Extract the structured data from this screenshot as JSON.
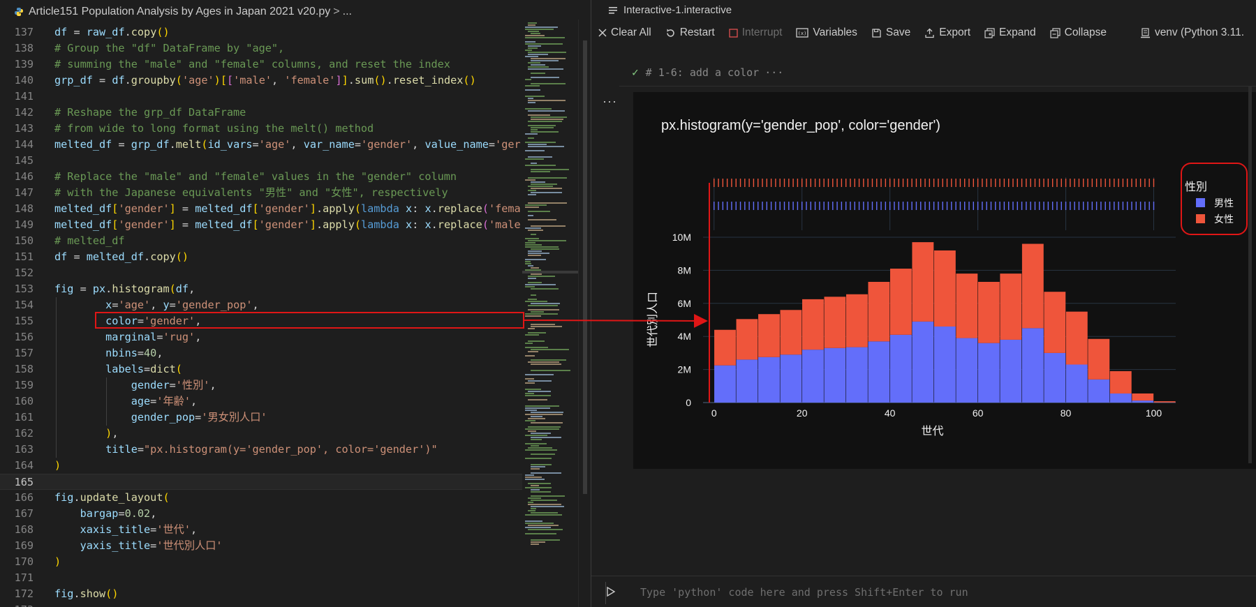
{
  "editor": {
    "breadcrumb": {
      "file": "Article151 Population Analysis by Ages in Japan 2021 v20.py",
      "sep": ">",
      "rest": "..."
    },
    "lines": [
      {
        "n": "137",
        "t": "df = raw_df.copy()"
      },
      {
        "n": "138",
        "t": "# Group the \"df\" DataFrame by \"age\","
      },
      {
        "n": "139",
        "t": "# summing the \"male\" and \"female\" columns, and reset the index"
      },
      {
        "n": "140",
        "t": "grp_df = df.groupby('age')[['male', 'female']].sum().reset_index()"
      },
      {
        "n": "141",
        "t": ""
      },
      {
        "n": "142",
        "t": "# Reshape the grp_df DataFrame"
      },
      {
        "n": "143",
        "t": "# from wide to long format using the melt() method"
      },
      {
        "n": "144",
        "t": "melted_df = grp_df.melt(id_vars='age', var_name='gender', value_name='ger"
      },
      {
        "n": "145",
        "t": ""
      },
      {
        "n": "146",
        "t": "# Replace the \"male\" and \"female\" values in the \"gender\" column"
      },
      {
        "n": "147",
        "t": "# with the Japanese equivalents \"男性\" and \"女性\", respectively"
      },
      {
        "n": "148",
        "t": "melted_df['gender'] = melted_df['gender'].apply(lambda x: x.replace('fema"
      },
      {
        "n": "149",
        "t": "melted_df['gender'] = melted_df['gender'].apply(lambda x: x.replace('male"
      },
      {
        "n": "150",
        "t": "# melted_df"
      },
      {
        "n": "151",
        "t": "df = melted_df.copy()"
      },
      {
        "n": "152",
        "t": ""
      },
      {
        "n": "153",
        "t": "fig = px.histogram(df,"
      },
      {
        "n": "154",
        "t": "        x='age', y='gender_pop',"
      },
      {
        "n": "155",
        "t": "        color='gender',"
      },
      {
        "n": "156",
        "t": "        marginal='rug',"
      },
      {
        "n": "157",
        "t": "        nbins=40,"
      },
      {
        "n": "158",
        "t": "        labels=dict("
      },
      {
        "n": "159",
        "t": "            gender='性別',"
      },
      {
        "n": "160",
        "t": "            age='年齢',"
      },
      {
        "n": "161",
        "t": "            gender_pop='男女別人口'"
      },
      {
        "n": "162",
        "t": "        ),"
      },
      {
        "n": "163",
        "t": "        title=\"px.histogram(y='gender_pop', color='gender')\""
      },
      {
        "n": "164",
        "t": ")"
      },
      {
        "n": "165",
        "t": ""
      },
      {
        "n": "166",
        "t": "fig.update_layout("
      },
      {
        "n": "167",
        "t": "    bargap=0.02,"
      },
      {
        "n": "168",
        "t": "    xaxis_title='世代',"
      },
      {
        "n": "169",
        "t": "    yaxis_title='世代別人口'"
      },
      {
        "n": "170",
        "t": ")"
      },
      {
        "n": "171",
        "t": ""
      },
      {
        "n": "172",
        "t": "fig.show()"
      },
      {
        "n": "173",
        "t": ""
      }
    ]
  },
  "interactive": {
    "tab_title": "Interactive-1.interactive",
    "toolbar": {
      "clear_all": "Clear All",
      "restart": "Restart",
      "interrupt": "Interrupt",
      "variables": "Variables",
      "save": "Save",
      "export": "Export",
      "expand": "Expand",
      "collapse": "Collapse",
      "kernel": "venv (Python 3.11."
    },
    "cell_header": "# 1-6: add a color",
    "cell_header_more": "···",
    "more_actions": "···",
    "input_placeholder": "Type 'python' code here and press Shift+Enter to run"
  },
  "colors": {
    "male": "#636efa",
    "female": "#ef553b",
    "annotation": "#e01616",
    "plot_bg": "#111111"
  },
  "chart_data": {
    "type": "bar",
    "title": "px.histogram(y='gender_pop', color='gender')",
    "xlabel": "世代",
    "ylabel": "世代別人口",
    "legend_title": "性別",
    "legend_position": "top-right",
    "barmode": "stack",
    "marginal": "rug",
    "xlim": [
      -2.5,
      105
    ],
    "ylim": [
      0,
      10000000
    ],
    "xticks": [
      0,
      20,
      40,
      60,
      80,
      100
    ],
    "yticks": [
      0,
      2000000,
      4000000,
      6000000,
      8000000,
      10000000
    ],
    "ytick_labels": [
      "0",
      "2M",
      "4M",
      "6M",
      "8M",
      "10M"
    ],
    "bin_starts": [
      0,
      5,
      10,
      15,
      20,
      25,
      30,
      35,
      40,
      45,
      50,
      55,
      60,
      65,
      70,
      75,
      80,
      85,
      90,
      95,
      100
    ],
    "bin_width": 5,
    "series": [
      {
        "name": "男性",
        "values": [
          2.25,
          2.6,
          2.75,
          2.9,
          3.2,
          3.3,
          3.35,
          3.7,
          4.1,
          4.9,
          4.6,
          3.9,
          3.6,
          3.8,
          4.5,
          3.0,
          2.3,
          1.4,
          0.55,
          0.12,
          0.01
        ]
      },
      {
        "name": "女性",
        "values": [
          2.15,
          2.45,
          2.6,
          2.7,
          3.05,
          3.1,
          3.2,
          3.6,
          4.0,
          4.8,
          4.6,
          3.9,
          3.7,
          4.0,
          5.1,
          3.7,
          3.2,
          2.45,
          1.35,
          0.43,
          0.07
        ]
      }
    ],
    "value_unit": "M"
  }
}
